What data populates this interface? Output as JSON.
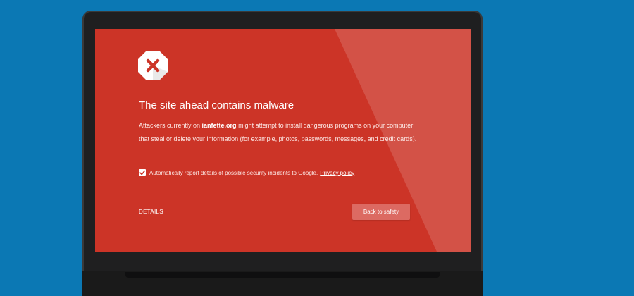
{
  "interstitial": {
    "title": "The site ahead contains malware",
    "message_before": "Attackers currently on ",
    "domain": "ianfette.org",
    "message_after": " might attempt to install dangerous programs on your computer that steal or delete your information (for example, photos, passwords, messages, and credit cards).",
    "report_label": "Automatically report details of possible security incidents to Google.",
    "report_checked": true,
    "privacy_link": "Privacy policy",
    "details_label": "DETAILS",
    "back_button_label": "Back to safety",
    "warning_icon": "stop-sign-x-icon",
    "checkbox_icon": "checkmark-icon"
  },
  "colors": {
    "page_background": "#0b78b4",
    "laptop_bezel": "#1f1f20",
    "screen_red": "#cc3427",
    "button_background": "#dc6a62",
    "icon_x": "#cc3427"
  }
}
